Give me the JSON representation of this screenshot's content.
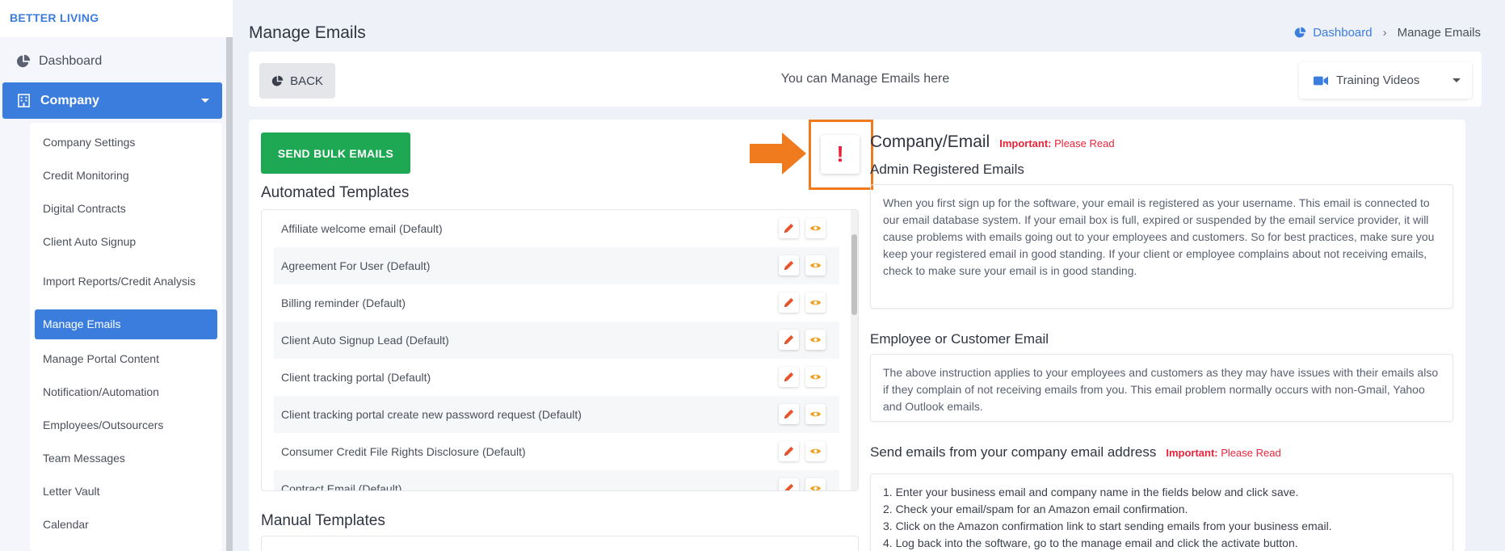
{
  "brand": "BETTER LIVING",
  "sidebar": {
    "dashboard": "Dashboard",
    "company": "Company",
    "submenu": [
      "Company Settings",
      "Credit Monitoring",
      "Digital Contracts",
      "Client Auto Signup",
      "Import Reports/Credit Analysis",
      "Manage Emails",
      "Manage Portal Content",
      "Notification/Automation",
      "Employees/Outsourcers",
      "Team Messages",
      "Letter Vault",
      "Calendar"
    ],
    "active_item": "Manage Emails"
  },
  "header": {
    "title": "Manage Emails",
    "breadcrumb": [
      "Dashboard",
      "Manage Emails"
    ]
  },
  "topbar": {
    "back_label": "BACK",
    "center_text": "You can Manage Emails here",
    "training_videos": "Training Videos"
  },
  "main": {
    "bulk_button": "SEND BULK EMAILS",
    "automated_title": "Automated Templates",
    "templates": [
      "Affiliate welcome email (Default)",
      "Agreement For User (Default)",
      "Billing reminder (Default)",
      "Client Auto Signup Lead (Default)",
      "Client tracking portal (Default)",
      "Client tracking portal create new password request (Default)",
      "Consumer Credit File Rights Disclosure (Default)",
      "Contract Email (Default)"
    ],
    "manual_title": "Manual Templates",
    "alert_symbol": "!"
  },
  "right": {
    "title": "Company/Email",
    "important_label": "Important:",
    "important_text": "Please Read",
    "admin_title": "Admin Registered Emails",
    "admin_text": "When you first sign up for the software, your email is registered as your username. This email is connected to our email database system. If your email box is full, expired or suspended by the email service provider, it will cause problems with emails going out to your employees and customers. So for best practices, make sure you keep your registered email in good standing. If your client or employee complains about not receiving emails, check to make sure your email is in good standing.",
    "emp_title": "Employee or Customer Email",
    "emp_text": "The above instruction applies to your employees and customers as they may have issues with their emails also if they complain of not receiving emails from you. This email problem normally occurs with non-Gmail, Yahoo and Outlook emails.",
    "send_title": "Send emails from your company email address",
    "steps": [
      "1. Enter your business email and company name in the fields below and click save.",
      "2. Check your email/spam for an Amazon email confirmation.",
      "3. Click on the Amazon confirmation link to start sending emails from your business email.",
      "4. Log back into the software, go to the manage email and click the activate button."
    ]
  },
  "colors": {
    "primary": "#3b7ddd",
    "success": "#1ea854",
    "danger": "#e8243a",
    "highlight": "#f07b1f",
    "edit_icon": "#e8542b",
    "view_icon": "#f0a020"
  }
}
